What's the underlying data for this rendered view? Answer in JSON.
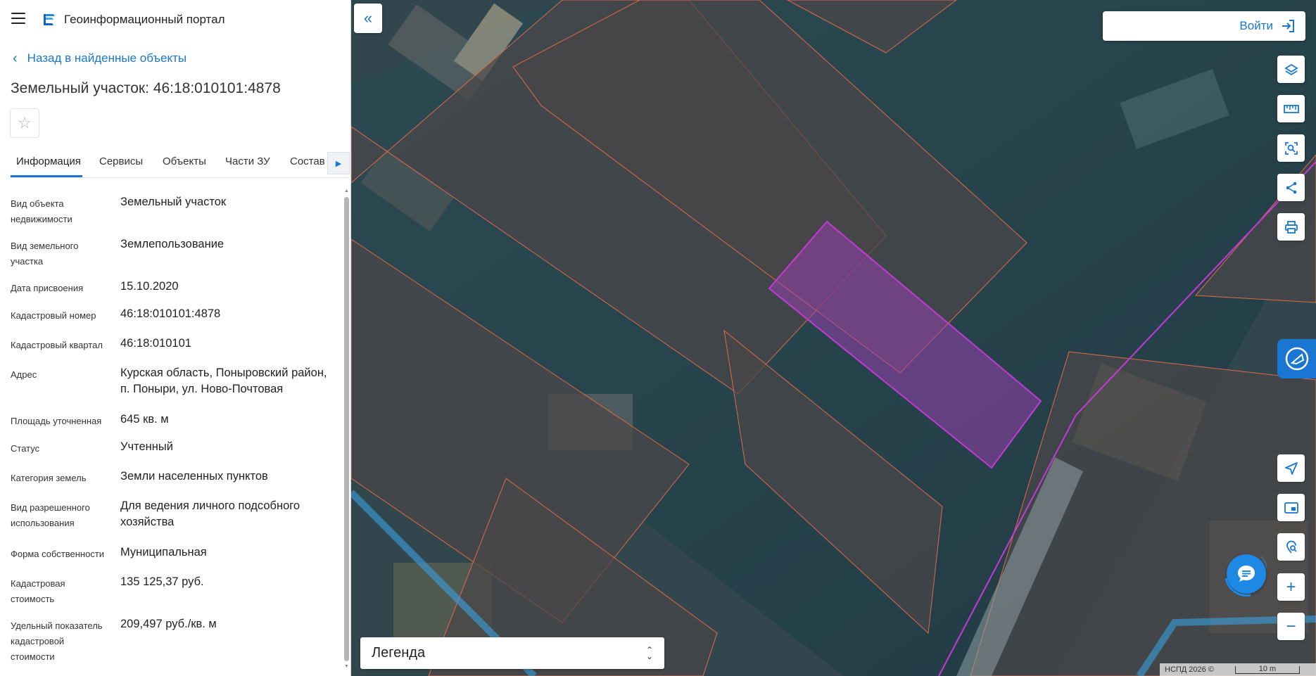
{
  "header": {
    "app_title": "Геоинформационный портал"
  },
  "nav": {
    "back_label": "Назад в найденные объекты"
  },
  "object": {
    "title": "Земельный участок: 46:18:010101:4878"
  },
  "tabs": [
    {
      "label": "Информация",
      "active": true
    },
    {
      "label": "Сервисы"
    },
    {
      "label": "Объекты"
    },
    {
      "label": "Части ЗУ"
    },
    {
      "label": "Состав"
    }
  ],
  "properties": [
    {
      "label": "Вид объекта недвижимости",
      "value": "Земельный участок"
    },
    {
      "label": "Вид земельного участка",
      "value": "Землепользование"
    },
    {
      "label": "Дата присвоения",
      "value": "15.10.2020"
    },
    {
      "label": "Кадастровый номер",
      "value": "46:18:010101:4878"
    },
    {
      "label": "Кадастровый квартал",
      "value": "46:18:010101"
    },
    {
      "label": "Адрес",
      "value": "Курская область, Поныровский район, п. Поныри, ул. Ново-Почтовая"
    },
    {
      "label": "Площадь уточненная",
      "value": "645 кв. м"
    },
    {
      "label": "Статус",
      "value": "Учтенный"
    },
    {
      "label": "Категория земель",
      "value": "Земли населенных пунктов"
    },
    {
      "label": "Вид разрешенного использования",
      "value": "Для ведения личного подсобного хозяйства"
    },
    {
      "label": "Форма собственности",
      "value": "Муниципальная"
    },
    {
      "label": "Кадастровая стоимость",
      "value": "135 125,37 руб."
    },
    {
      "label": "Удельный показатель кадастровой стоимости",
      "value": "209,497 руб./кв. м"
    }
  ],
  "map": {
    "login_label": "Войти",
    "legend_label": "Легенда",
    "attribution": "НСПД 2026 ©",
    "scale_label": "10 m",
    "colors": {
      "accent": "#1976d2",
      "parcel_outline": "#e06a4a",
      "selected_parcel": "#b33cc9"
    }
  },
  "icons": {
    "layers": "layers-icon",
    "ruler": "ruler-icon",
    "select": "area-select-icon",
    "share": "share-icon",
    "print": "print-icon",
    "locate": "navigation-arrow-icon",
    "minimap": "minimap-icon",
    "geo-search": "geo-search-icon",
    "zoom-in": "plus-icon",
    "zoom-out": "minus-icon",
    "chat": "chat-icon"
  }
}
